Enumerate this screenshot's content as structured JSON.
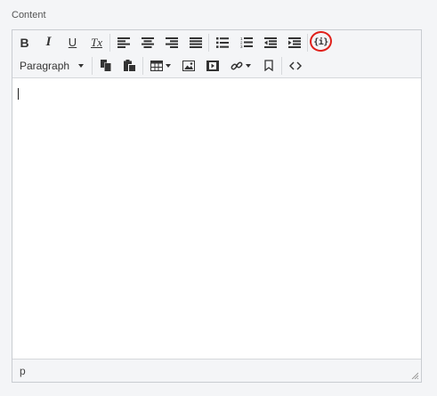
{
  "field": {
    "label": "Content"
  },
  "toolbar": {
    "bold_label": "B",
    "italic_label": "I",
    "underline_label": "U",
    "clear_format_label": "Tx",
    "block_format_value": "Paragraph",
    "icons": {
      "bold": "bold-icon",
      "italic": "italic-icon",
      "underline": "underline-icon",
      "clear_format": "clear-formatting-icon",
      "align_left": "align-left-icon",
      "align_center": "align-center-icon",
      "align_right": "align-right-icon",
      "align_justify": "align-justify-icon",
      "bullet_list": "bullet-list-icon",
      "numbered_list": "numbered-list-icon",
      "outdent": "outdent-icon",
      "indent": "indent-icon",
      "template_variable": "template-variable-icon",
      "copy": "copy-icon",
      "paste": "paste-icon",
      "table": "table-icon",
      "image": "image-icon",
      "media": "media-icon",
      "link": "link-icon",
      "bookmark": "bookmark-icon",
      "source_code": "source-code-icon"
    }
  },
  "statusbar": {
    "path": "p"
  },
  "colors": {
    "annotation_circle": "#e0201a",
    "border": "#c9ccd1",
    "toolbar_bg": "#f4f5f7"
  }
}
